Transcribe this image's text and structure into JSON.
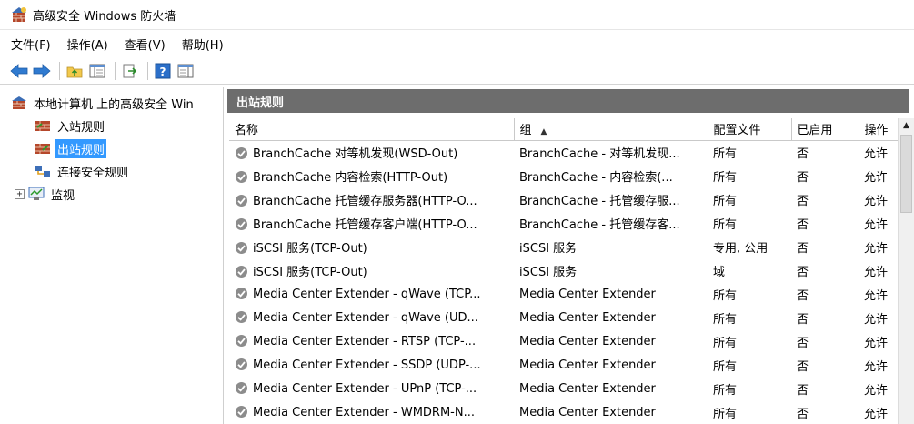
{
  "window": {
    "title": "高级安全 Windows 防火墙"
  },
  "menu": [
    {
      "label": "文件(F)"
    },
    {
      "label": "操作(A)"
    },
    {
      "label": "查看(V)"
    },
    {
      "label": "帮助(H)"
    }
  ],
  "toolbar": {
    "icons": [
      "back-icon",
      "forward-icon",
      "folder-up-icon",
      "show-hide-tree-icon",
      "export-icon",
      "help-icon",
      "properties-icon"
    ]
  },
  "tree": {
    "root": "本地计算机 上的高级安全 Win",
    "items": [
      {
        "label": "入站规则"
      },
      {
        "label": "出站规则",
        "selected": true
      },
      {
        "label": "连接安全规则"
      },
      {
        "label": "监视",
        "expander": "+"
      }
    ]
  },
  "main": {
    "section_title": "出站规则",
    "columns": [
      {
        "label": "名称"
      },
      {
        "label": "组",
        "sort": "▲"
      },
      {
        "label": "配置文件"
      },
      {
        "label": "已启用"
      },
      {
        "label": "操作"
      }
    ],
    "rows": [
      [
        "BranchCache 对等机发现(WSD-Out)",
        "BranchCache - 对等机发现...",
        "所有",
        "否",
        "允许"
      ],
      [
        "BranchCache 内容检索(HTTP-Out)",
        "BranchCache - 内容检索(...",
        "所有",
        "否",
        "允许"
      ],
      [
        "BranchCache 托管缓存服务器(HTTP-O...",
        "BranchCache - 托管缓存服...",
        "所有",
        "否",
        "允许"
      ],
      [
        "BranchCache 托管缓存客户端(HTTP-O...",
        "BranchCache - 托管缓存客...",
        "所有",
        "否",
        "允许"
      ],
      [
        "iSCSI 服务(TCP-Out)",
        "iSCSI 服务",
        "专用, 公用",
        "否",
        "允许"
      ],
      [
        "iSCSI 服务(TCP-Out)",
        "iSCSI 服务",
        "域",
        "否",
        "允许"
      ],
      [
        "Media Center Extender - qWave (TCP...",
        "Media Center Extender",
        "所有",
        "否",
        "允许"
      ],
      [
        "Media Center Extender - qWave (UD...",
        "Media Center Extender",
        "所有",
        "否",
        "允许"
      ],
      [
        "Media Center Extender - RTSP (TCP-...",
        "Media Center Extender",
        "所有",
        "否",
        "允许"
      ],
      [
        "Media Center Extender - SSDP (UDP-...",
        "Media Center Extender",
        "所有",
        "否",
        "允许"
      ],
      [
        "Media Center Extender - UPnP (TCP-...",
        "Media Center Extender",
        "所有",
        "否",
        "允许"
      ],
      [
        "Media Center Extender - WMDRM-N...",
        "Media Center Extender",
        "所有",
        "否",
        "允许"
      ]
    ]
  },
  "colors": {
    "selection": "#3399ff",
    "section_header_bg": "#6d6d6d",
    "rule_icon": "#8c8c8c"
  }
}
